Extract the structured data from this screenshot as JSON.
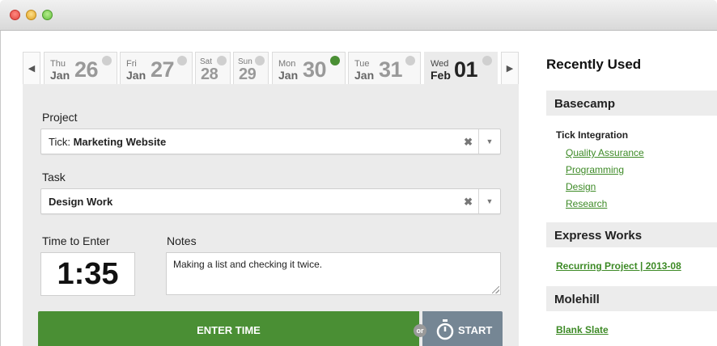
{
  "days": [
    {
      "dow": "Thu",
      "month": "Jan",
      "num": "26",
      "has_time": false,
      "active": false
    },
    {
      "dow": "Fri",
      "month": "Jan",
      "num": "27",
      "has_time": false,
      "active": false
    },
    {
      "dow": "Sat",
      "month": "",
      "num": "28",
      "has_time": false,
      "active": false
    },
    {
      "dow": "Sun",
      "month": "",
      "num": "29",
      "has_time": false,
      "active": false
    },
    {
      "dow": "Mon",
      "month": "Jan",
      "num": "30",
      "has_time": true,
      "active": false
    },
    {
      "dow": "Tue",
      "month": "Jan",
      "num": "31",
      "has_time": false,
      "active": false
    },
    {
      "dow": "Wed",
      "month": "Feb",
      "num": "01",
      "has_time": false,
      "active": true
    }
  ],
  "nav": {
    "prev_glyph": "◀",
    "next_glyph": "▶"
  },
  "form": {
    "project_label": "Project",
    "project_prefix": "Tick: ",
    "project_name": "Marketing Website",
    "task_label": "Task",
    "task_name": "Design Work",
    "clear_glyph": "✖",
    "caret_glyph": "▼",
    "time_label": "Time to Enter",
    "time_value": "1:35",
    "notes_label": "Notes",
    "notes_value": "Making a list and checking it twice.",
    "enter_button": "ENTER TIME",
    "or_text": "or",
    "start_button": "START"
  },
  "recent": {
    "title": "Recently Used",
    "groups": [
      {
        "name": "Basecamp",
        "sub": "Tick Integration",
        "links": [
          "Quality Assurance",
          "Programming",
          "Design",
          "Research"
        ]
      },
      {
        "name": "Express Works",
        "links": [
          "Recurring Project | 2013-08"
        ]
      },
      {
        "name": "Molehill",
        "links": [
          "Blank Slate"
        ]
      }
    ]
  },
  "colors": {
    "accent_green": "#4a8f34",
    "start_gray": "#758694",
    "link_green": "#3d8a26"
  }
}
